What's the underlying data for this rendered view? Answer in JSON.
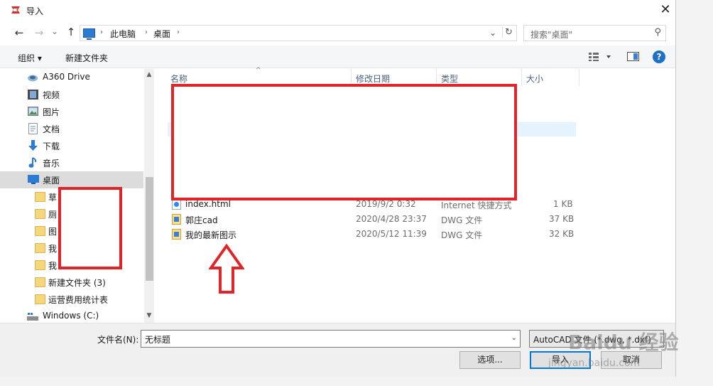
{
  "window": {
    "title": "导入",
    "close_glyph": "✕"
  },
  "nav": {
    "back": "←",
    "forward": "→",
    "recent": "⌄",
    "up": "↑"
  },
  "address": {
    "crumbs": [
      "此电脑",
      "桌面"
    ],
    "sep": "›",
    "dropdown": "⌄",
    "refresh": "↻"
  },
  "search": {
    "placeholder": "搜索\"桌面\"",
    "icon": "⚲"
  },
  "toolbar": {
    "organize": "组织 ▾",
    "new_folder": "新建文件夹",
    "help": "?"
  },
  "sidebar": {
    "items": [
      {
        "label": "A360 Drive",
        "icon": "cloud-drive-icon"
      },
      {
        "label": "视频",
        "icon": "video-icon"
      },
      {
        "label": "图片",
        "icon": "picture-icon"
      },
      {
        "label": "文档",
        "icon": "document-icon"
      },
      {
        "label": "下载",
        "icon": "download-icon"
      },
      {
        "label": "音乐",
        "icon": "music-icon"
      },
      {
        "label": "桌面",
        "icon": "desktop-icon",
        "selected": true
      },
      {
        "label": "草",
        "icon": "folder-icon"
      },
      {
        "label": "厕",
        "icon": "folder-icon"
      },
      {
        "label": "图",
        "icon": "folder-icon"
      },
      {
        "label": "我",
        "icon": "folder-icon"
      },
      {
        "label": "我",
        "icon": "folder-icon"
      },
      {
        "label": "新建文件夹 (3)",
        "icon": "folder-icon"
      },
      {
        "label": "运营费用统计表",
        "icon": "folder-icon"
      },
      {
        "label": "Windows (C:)",
        "icon": "drive-icon"
      }
    ]
  },
  "columns": {
    "name": "名称",
    "date": "修改日期",
    "type": "类型",
    "size": "大小"
  },
  "files": [
    {
      "name": "index.html",
      "date": "2019/9/2 0:32",
      "type": "Internet 快捷方式",
      "size": "1 KB",
      "kind": "html"
    },
    {
      "name": "郭庄cad",
      "date": "2020/4/28 23:37",
      "type": "DWG 文件",
      "size": "37 KB",
      "kind": "dwg"
    },
    {
      "name": "我的最新图示",
      "date": "2020/5/12 11:39",
      "type": "DWG 文件",
      "size": "32 KB",
      "kind": "dwg"
    }
  ],
  "bottom": {
    "filename_label": "文件名(N):",
    "filename_value": "无标题",
    "filetype_value": "AutoCAD 文件 (*.dwg, *.dxf)",
    "options_button": "选项...",
    "open_button": "导入",
    "cancel_button": "取消"
  },
  "watermark": {
    "brand": "Baidu 经验",
    "url": "jingyan.baidu.com"
  },
  "colors": {
    "annotation_red": "#e0252a",
    "selection": "#dcdcdc",
    "accent": "#0078d7"
  }
}
